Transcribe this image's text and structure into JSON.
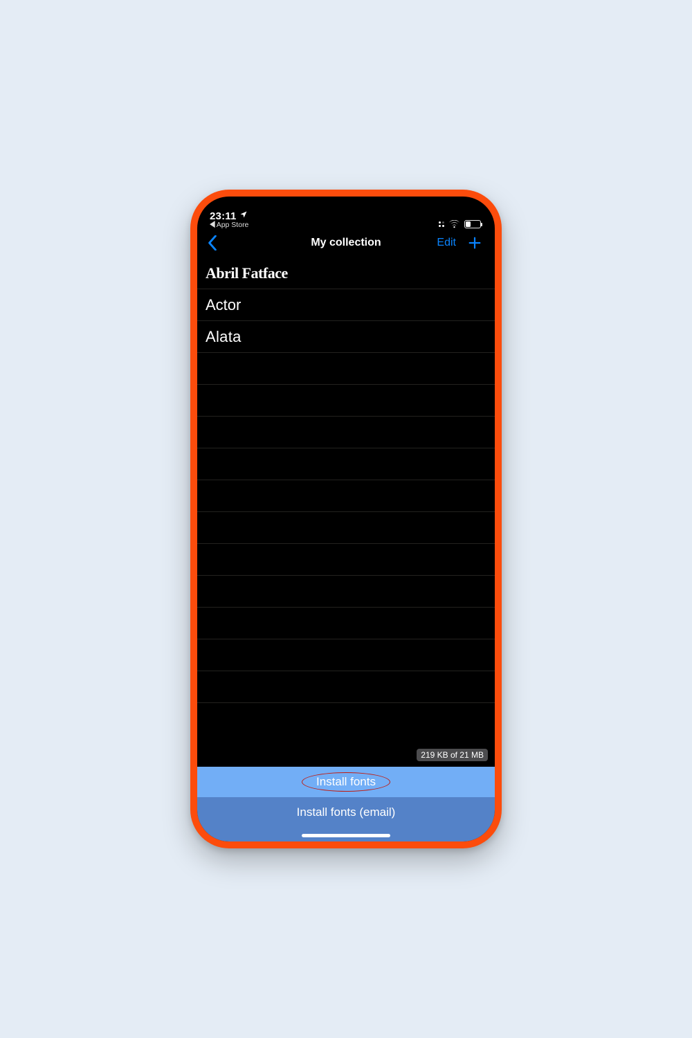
{
  "status_bar": {
    "time": "23:11",
    "back_app": "App Store"
  },
  "nav": {
    "title": "My collection",
    "edit": "Edit"
  },
  "fonts": [
    {
      "name": "Abril Fatface"
    },
    {
      "name": "Actor"
    },
    {
      "name": "Alata"
    }
  ],
  "storage_text": "219 KB of 21 MB",
  "buttons": {
    "install": "Install fonts",
    "install_email": "Install fonts (email)"
  }
}
